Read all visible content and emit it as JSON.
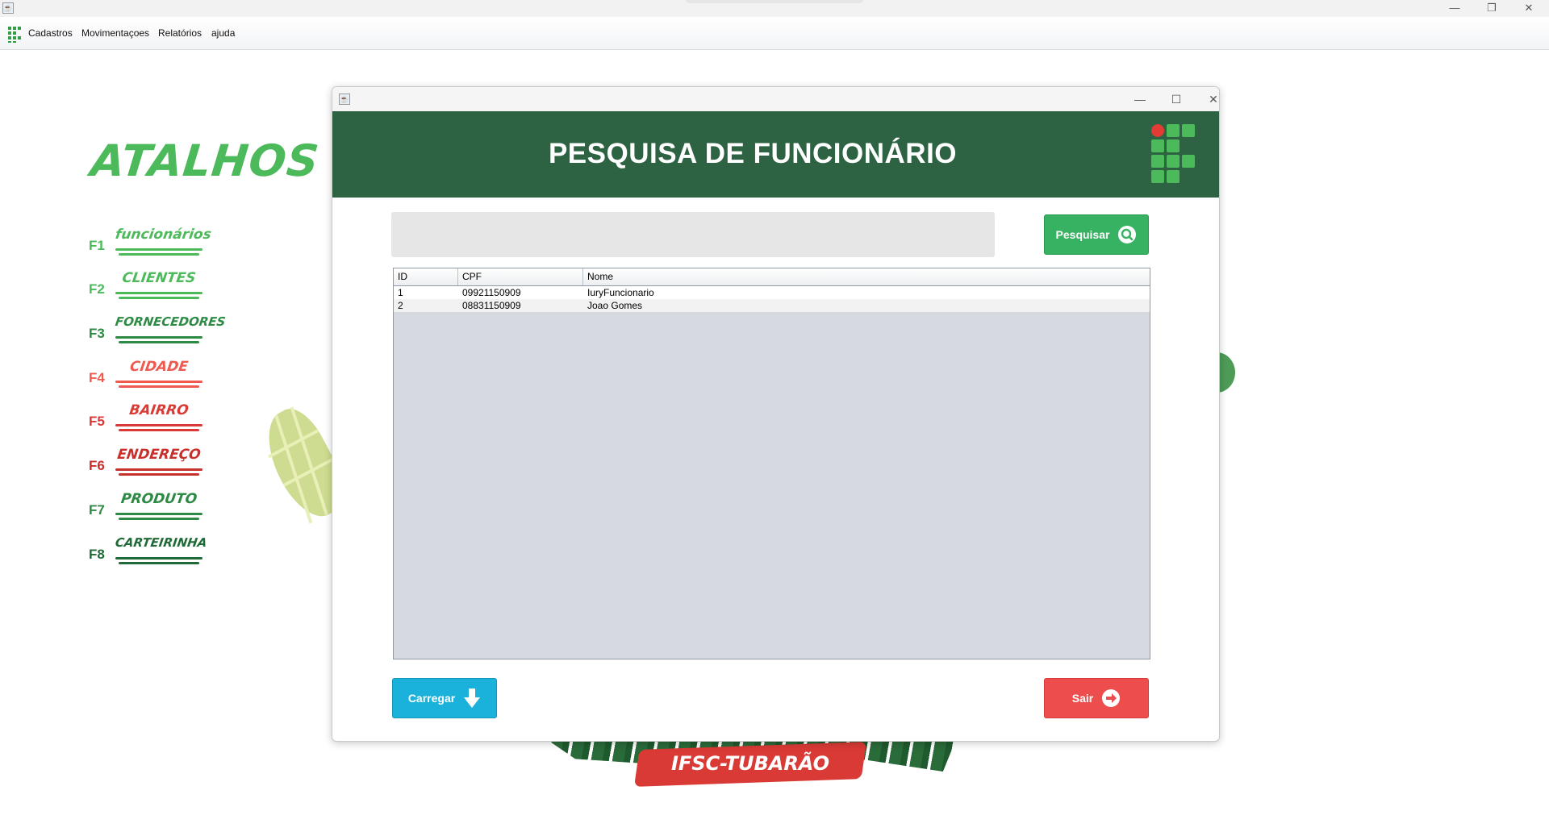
{
  "window": {
    "controls": {
      "minimize": "—",
      "maximize": "❐",
      "close": "✕"
    }
  },
  "menubar": {
    "items": [
      "Cadastros",
      "Movimentaçoes",
      "Relatórios",
      "ajuda"
    ]
  },
  "shortcuts": {
    "title": "ATALHOS",
    "items": [
      {
        "key": "F1",
        "label": "funcionários",
        "color": "#4cba5a"
      },
      {
        "key": "F2",
        "label": "CLIENTES",
        "color": "#4cba5a"
      },
      {
        "key": "F3",
        "label": "FORNECEDORES",
        "color": "#2d8a44"
      },
      {
        "key": "F4",
        "label": "CIDADE",
        "color": "#ee5a50"
      },
      {
        "key": "F5",
        "label": "BAIRRO",
        "color": "#d93a35"
      },
      {
        "key": "F6",
        "label": "ENDEREÇO",
        "color": "#c8302c"
      },
      {
        "key": "F7",
        "label": "PRODUTO",
        "color": "#2d8a44"
      },
      {
        "key": "F8",
        "label": "CARTEIRINHA",
        "color": "#1f6a37"
      }
    ]
  },
  "background": {
    "campus_tag": "IFSC-TUBARÃO"
  },
  "dialog": {
    "controls": {
      "minimize": "—",
      "maximize": "☐",
      "close": "✕"
    },
    "title": "PESQUISA DE FUNCIONÁRIO",
    "search": {
      "value": "",
      "placeholder": ""
    },
    "search_button": "Pesquisar",
    "table": {
      "columns": [
        "ID",
        "CPF",
        "Nome"
      ],
      "rows": [
        [
          "1",
          "09921150909",
          "IuryFuncionario"
        ],
        [
          "2",
          "08831150909",
          "Joao Gomes"
        ]
      ]
    },
    "load_button": "Carregar",
    "exit_button": "Sair"
  },
  "colors": {
    "banner": "#2d6342",
    "search_button": "#36b262",
    "load_button": "#1ab2da",
    "exit_button": "#ee4d4d",
    "brand_green": "#4cba5a",
    "brand_red": "#e23c35"
  }
}
